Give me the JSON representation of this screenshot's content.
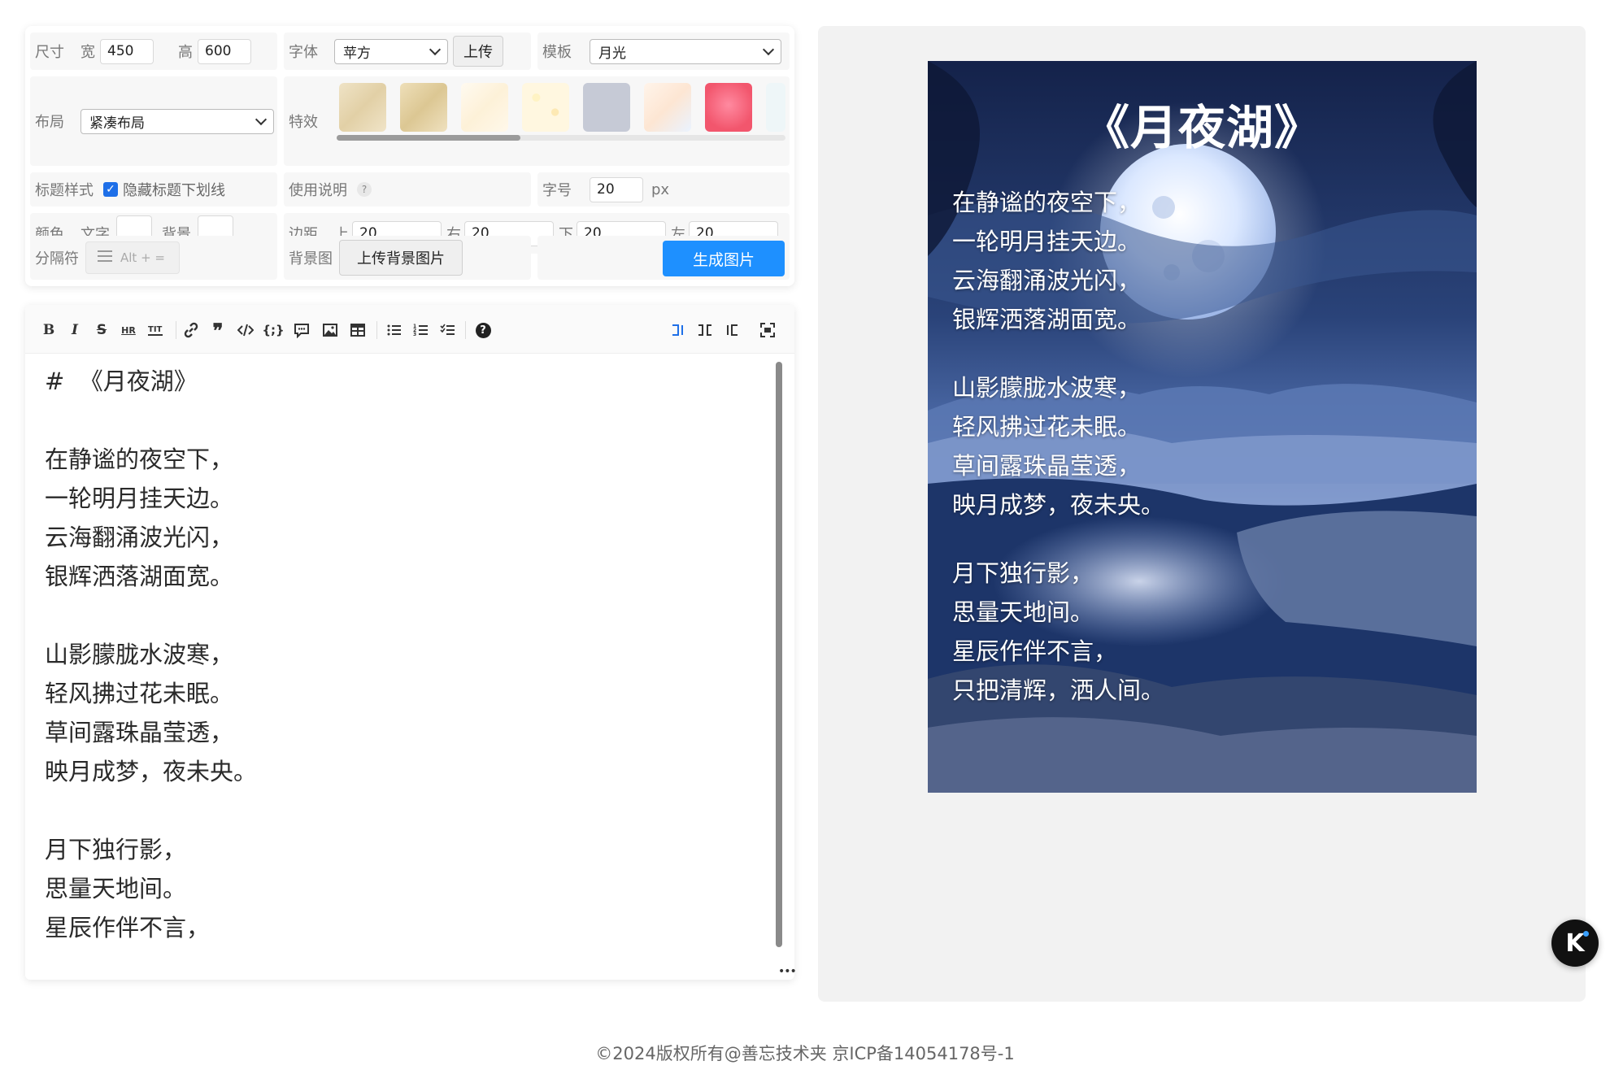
{
  "settings": {
    "size": {
      "label": "尺寸",
      "width_label": "宽",
      "width": "450",
      "height_label": "高",
      "height": "600"
    },
    "font": {
      "label": "字体",
      "value": "苹方",
      "upload_label": "上传"
    },
    "template": {
      "label": "模板",
      "value": "月光"
    },
    "layout": {
      "label": "布局",
      "value": "紧凑布局"
    },
    "effects": {
      "label": "特效"
    },
    "title_style": {
      "label": "标题样式",
      "checkbox_label": "隐藏标题下划线",
      "checked": true
    },
    "help": {
      "label": "使用说明",
      "icon": "?"
    },
    "font_size": {
      "label": "字号",
      "value": "20",
      "unit": "px"
    },
    "color": {
      "label": "颜色",
      "text_label": "文字",
      "bg_label": "背景"
    },
    "margin": {
      "label": "边距",
      "top_label": "上",
      "top": "20",
      "right_label": "右",
      "right": "20",
      "bottom_label": "下",
      "bottom": "20",
      "left_label": "左",
      "left": "20"
    },
    "separator": {
      "label": "分隔符",
      "placeholder": "Alt + ="
    },
    "bg_image": {
      "label": "背景图",
      "button": "上传背景图片"
    },
    "generate_button": "生成图片"
  },
  "editor": {
    "toolbar": [
      "bold",
      "italic",
      "strikethrough",
      "hr",
      "title",
      "link",
      "quote",
      "code",
      "code-block",
      "comment",
      "image",
      "table",
      "unordered-list",
      "ordered-list",
      "task-list",
      "help",
      "preview-left",
      "preview-both",
      "preview-right",
      "fullscreen"
    ],
    "hr_label": "HR",
    "lines": [
      "#  《月夜湖》",
      "",
      "在静谧的夜空下，",
      "一轮明月挂天边。",
      "云海翻涌波光闪，",
      "银辉洒落湖面宽。",
      "",
      "山影朦胧水波寒，",
      "轻风拂过花未眠。",
      "草间露珠晶莹透，",
      "映月成梦，夜未央。",
      "",
      "月下独行影，",
      "思量天地间。",
      "星辰作伴不言，",
      "只把清辉，洒人间。"
    ]
  },
  "poster": {
    "title": "《月夜湖》",
    "stanzas": [
      [
        "在静谧的夜空下，",
        "一轮明月挂天边。",
        "云海翻涌波光闪，",
        "银辉洒落湖面宽。"
      ],
      [
        "山影朦胧水波寒，",
        "轻风拂过花未眠。",
        "草间露珠晶莹透，",
        "映月成梦，夜未央。"
      ],
      [
        "月下独行影，",
        "思量天地间。",
        "星辰作伴不言，",
        "只把清辉，洒人间。"
      ]
    ]
  },
  "colors": {
    "accent": "#1e90ff",
    "panel_bg": "#f2f2f2",
    "poster_sky": "#1b2a55"
  },
  "footer": "©2024版权所有@善忘技术夹 京ICP备14054178号-1",
  "float_button": "K"
}
